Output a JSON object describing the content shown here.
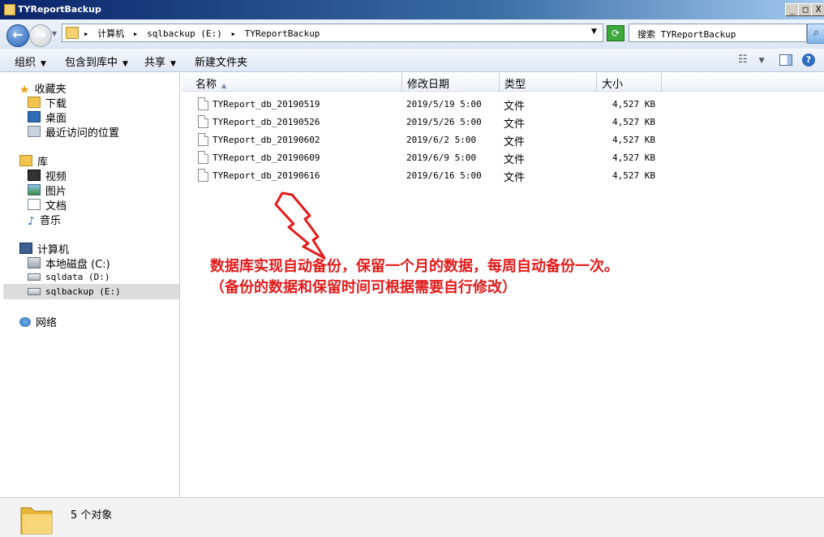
{
  "window": {
    "title": "TYReportBackup",
    "min": "_",
    "max": "□",
    "close": "X"
  },
  "address": {
    "crumbs": [
      "计算机",
      "sqlbackup (E:)",
      "TYReportBackup"
    ],
    "arrow": "▸"
  },
  "search": {
    "placeholder": "搜索 TYReportBackup"
  },
  "toolbar": {
    "organize": "组织",
    "include_library": "包含到库中",
    "share": "共享",
    "new_folder": "新建文件夹"
  },
  "nav": {
    "favorites": "收藏夹",
    "downloads": "下载",
    "desktop": "桌面",
    "recent": "最近访问的位置",
    "libraries": "库",
    "videos": "视频",
    "pictures": "图片",
    "documents": "文档",
    "music": "音乐",
    "computer": "计算机",
    "drive_c": "本地磁盘 (C:)",
    "drive_d": "sqldata (D:)",
    "drive_e": "sqlbackup (E:)",
    "network": "网络"
  },
  "columns": {
    "name": "名称",
    "modified": "修改日期",
    "type": "类型",
    "size": "大小"
  },
  "files": [
    {
      "name": "TYReport_db_20190519",
      "modified": "2019/5/19 5:00",
      "type": "文件",
      "size": "4,527 KB"
    },
    {
      "name": "TYReport_db_20190526",
      "modified": "2019/5/26 5:00",
      "type": "文件",
      "size": "4,527 KB"
    },
    {
      "name": "TYReport_db_20190602",
      "modified": "2019/6/2 5:00",
      "type": "文件",
      "size": "4,527 KB"
    },
    {
      "name": "TYReport_db_20190609",
      "modified": "2019/6/9 5:00",
      "type": "文件",
      "size": "4,527 KB"
    },
    {
      "name": "TYReport_db_20190616",
      "modified": "2019/6/16 5:00",
      "type": "文件",
      "size": "4,527 KB"
    }
  ],
  "annotation": {
    "line1": "数据库实现自动备份，保留一个月的数据，每周自动备份一次。",
    "line2": "（备份的数据和保留时间可根据需要自行修改）",
    "color": "#e31b1b"
  },
  "status": {
    "count": "5 个对象"
  }
}
